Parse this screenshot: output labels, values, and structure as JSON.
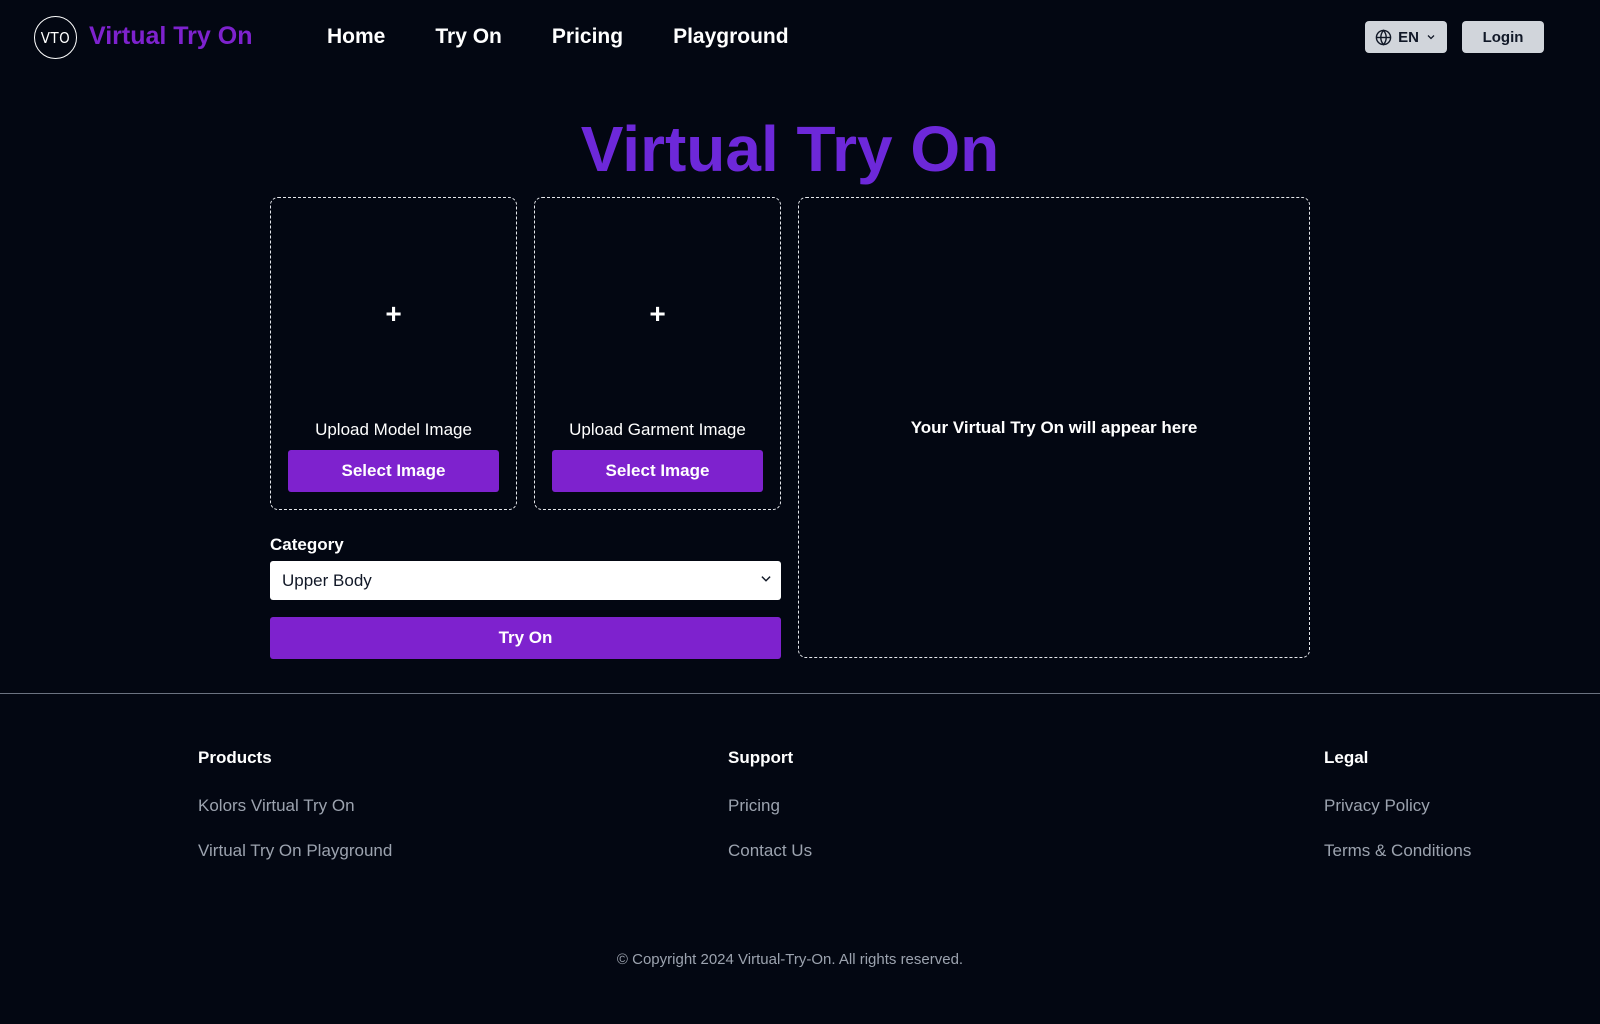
{
  "header": {
    "logo_text": "VTO",
    "brand": "Virtual Try On",
    "nav": [
      {
        "label": "Home"
      },
      {
        "label": "Try On"
      },
      {
        "label": "Pricing"
      },
      {
        "label": "Playground"
      }
    ],
    "language": "EN",
    "login_label": "Login"
  },
  "main": {
    "title": "Virtual Try On",
    "model_card": {
      "plus": "+",
      "label": "Upload Model Image",
      "button": "Select Image"
    },
    "garment_card": {
      "plus": "+",
      "label": "Upload Garment Image",
      "button": "Select Image"
    },
    "result_placeholder": "Your Virtual Try On will appear here",
    "category_label": "Category",
    "category_value": "Upper Body",
    "tryon_button": "Try On"
  },
  "footer": {
    "products": {
      "heading": "Products",
      "links": [
        "Kolors Virtual Try On",
        "Virtual Try On Playground"
      ]
    },
    "support": {
      "heading": "Support",
      "links": [
        "Pricing",
        "Contact Us"
      ]
    },
    "legal": {
      "heading": "Legal",
      "links": [
        "Privacy Policy",
        "Terms & Conditions"
      ]
    },
    "copyright": "© Copyright 2024 Virtual-Try-On. All rights reserved."
  },
  "colors": {
    "background": "#030712",
    "accent": "#7e22ce",
    "title": "#6d28d9",
    "muted_text": "#9ca3af",
    "button_light": "#d1d5db"
  }
}
